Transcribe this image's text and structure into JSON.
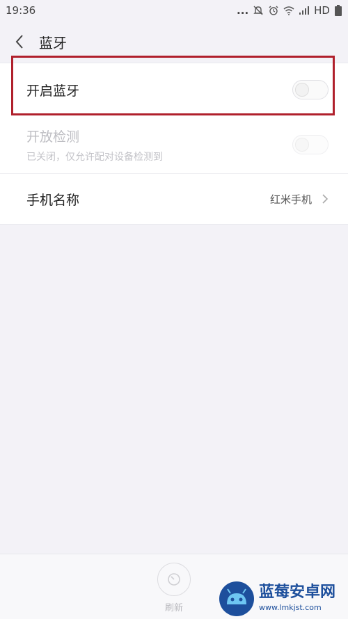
{
  "status_bar": {
    "time": "19:36",
    "dots": "...",
    "network": "HD"
  },
  "header": {
    "title": "蓝牙"
  },
  "settings": {
    "bluetooth": {
      "label": "开启蓝牙",
      "enabled": false
    },
    "discoverable": {
      "label": "开放检测",
      "description": "已关闭，仅允许配对设备检测到",
      "enabled": false,
      "disabled": true
    },
    "device_name": {
      "label": "手机名称",
      "value": "红米手机"
    }
  },
  "bottom_bar": {
    "refresh_label": "刷新"
  },
  "watermark": {
    "main": "蓝莓安卓网",
    "sub": "www.lmkjst.com"
  },
  "colors": {
    "highlight": "#b0202c",
    "background": "#f3f2f7",
    "watermark": "#1d4f9c"
  }
}
